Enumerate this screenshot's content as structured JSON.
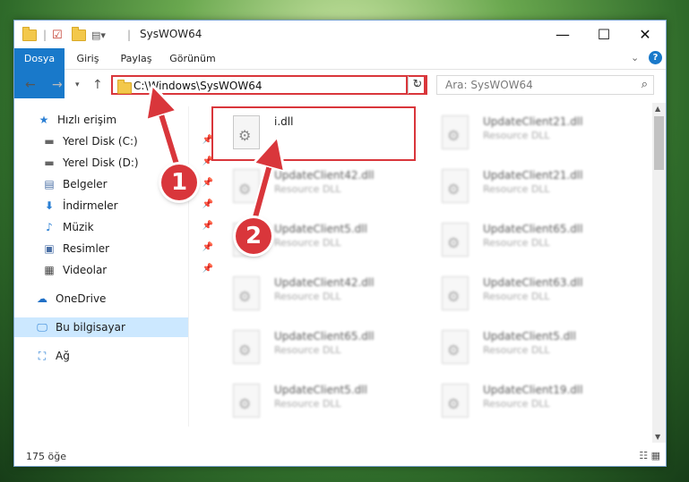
{
  "window": {
    "title": "SysWOW64",
    "controls": {
      "minimize": "—",
      "maximize": "☐",
      "close": "✕"
    }
  },
  "ribbon": {
    "tabs": [
      "Dosya",
      "Giriş",
      "Paylaş",
      "Görünüm"
    ]
  },
  "nav": {
    "address": "C:\\Windows\\SysWOW64",
    "search_placeholder": "Ara: SysWOW64"
  },
  "sidebar": {
    "items": [
      {
        "label": "Hızlı erişim",
        "icon": "star-icon",
        "pinned": false
      },
      {
        "label": "Yerel Disk (C:)",
        "icon": "drive-icon",
        "pinned": true
      },
      {
        "label": "Yerel Disk (D:)",
        "icon": "drive-icon",
        "pinned": true
      },
      {
        "label": "Belgeler",
        "icon": "documents-icon",
        "pinned": true
      },
      {
        "label": "İndirmeler",
        "icon": "download-icon",
        "pinned": true
      },
      {
        "label": "Müzik",
        "icon": "music-icon",
        "pinned": true
      },
      {
        "label": "Resimler",
        "icon": "pictures-icon",
        "pinned": true
      },
      {
        "label": "Videolar",
        "icon": "videos-icon",
        "pinned": true
      },
      {
        "label": "OneDrive",
        "icon": "cloud-icon",
        "pinned": false
      },
      {
        "label": "Bu bilgisayar",
        "icon": "computer-icon",
        "pinned": false,
        "selected": true
      },
      {
        "label": "Ağ",
        "icon": "network-icon",
        "pinned": false
      }
    ]
  },
  "files": [
    {
      "name": "i.dll",
      "type": "",
      "highlighted": true
    },
    {
      "name": "UpdateClient21.dll",
      "type": "Resource DLL"
    },
    {
      "name": "UpdateClient42.dll",
      "type": "Resource DLL"
    },
    {
      "name": "UpdateClient21.dll",
      "type": "Resource DLL"
    },
    {
      "name": "UpdateClient5.dll",
      "type": "Resource DLL"
    },
    {
      "name": "UpdateClient65.dll",
      "type": "Resource DLL"
    },
    {
      "name": "UpdateClient42.dll",
      "type": "Resource DLL"
    },
    {
      "name": "UpdateClient63.dll",
      "type": "Resource DLL"
    },
    {
      "name": "UpdateClient65.dll",
      "type": "Resource DLL"
    },
    {
      "name": "UpdateClient5.dll",
      "type": "Resource DLL"
    },
    {
      "name": "UpdateClient5.dll",
      "type": "Resource DLL"
    },
    {
      "name": "UpdateClient19.dll",
      "type": "Resource DLL"
    }
  ],
  "status": {
    "count": "175 öğe"
  },
  "annotations": {
    "step1": "1",
    "step2": "2",
    "color": "#d9363b"
  }
}
